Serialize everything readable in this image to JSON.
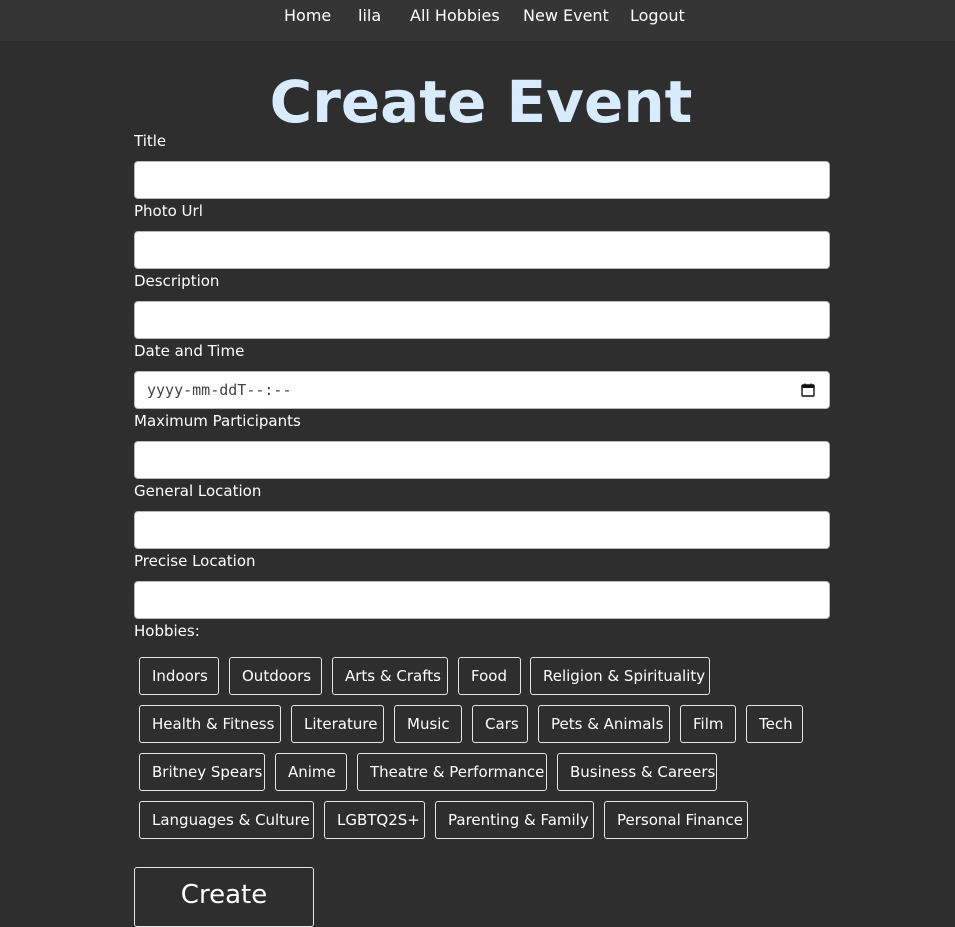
{
  "nav": {
    "home": "Home",
    "user": "lila",
    "all_hobbies": "All Hobbies",
    "new_event": "New Event",
    "logout": "Logout"
  },
  "page": {
    "title": "Create Event"
  },
  "form": {
    "title_label": "Title",
    "photo_label": "Photo Url",
    "description_label": "Description",
    "datetime_label": "Date and Time",
    "datetime_value": "yyyy-mm-ddT--:--",
    "max_participants_label": "Maximum Participants",
    "general_location_label": "General Location",
    "precise_location_label": "Precise Location",
    "hobbies_label": "Hobbies:",
    "submit_label": "Create"
  },
  "hobbies": [
    "Indoors",
    "Outdoors",
    "Arts & Crafts",
    "Food",
    "Religion & Spirituality",
    "Health & Fitness",
    "Literature",
    "Music",
    "Cars",
    "Pets & Animals",
    "Film",
    "Tech",
    "Britney Spears",
    "Anime",
    "Theatre & Performance",
    "Business & Careers",
    "Languages & Culture",
    "LGBTQ2S+",
    "Parenting & Family",
    "Personal Finance"
  ],
  "icons": {
    "date_picker": "calendar-icon"
  },
  "colors": {
    "background": "#2e2e2e",
    "nav_background": "#353535",
    "title": "#d9ebff"
  }
}
